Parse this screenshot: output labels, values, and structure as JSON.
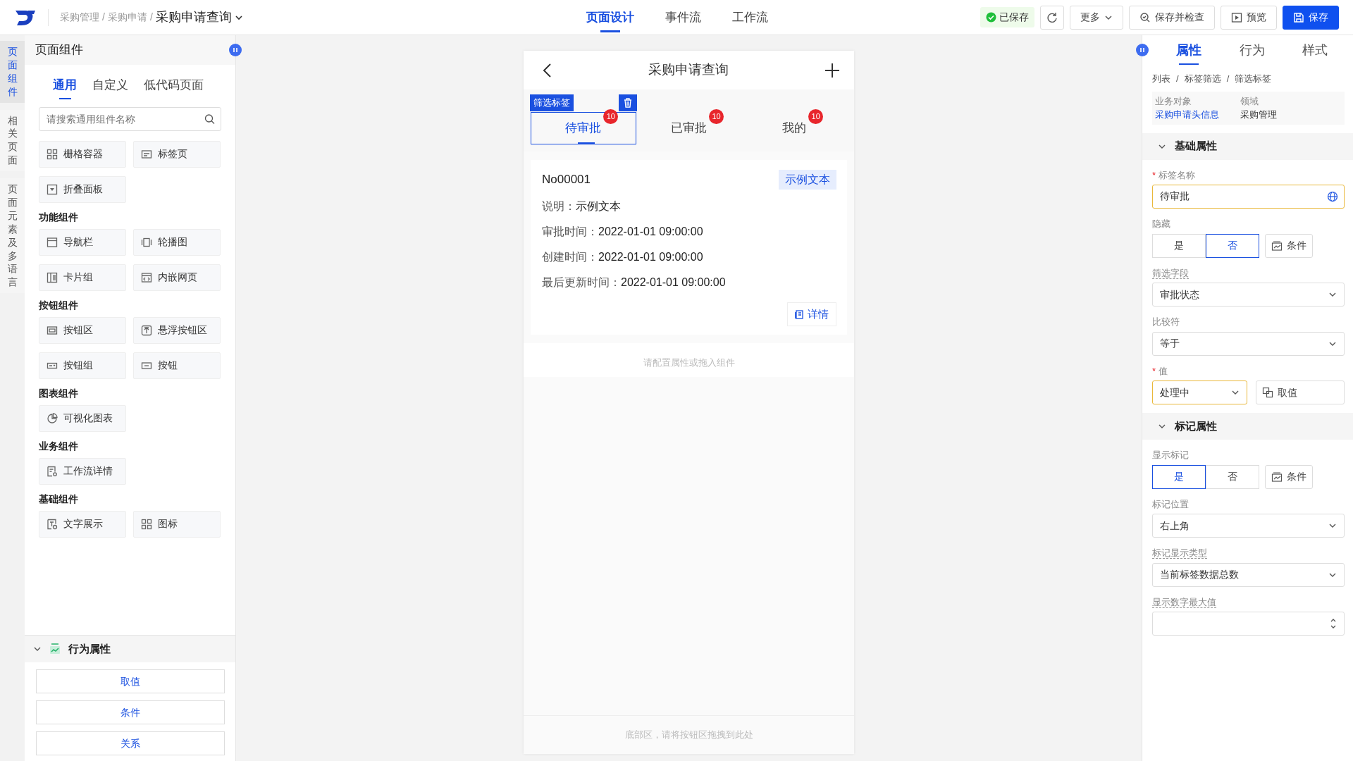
{
  "topbar": {
    "breadcrumb": [
      "采购管理",
      "采购申请"
    ],
    "separator": "/",
    "page_title": "采购申请查询",
    "tabs": [
      {
        "label": "页面设计",
        "selected": true
      },
      {
        "label": "事件流",
        "selected": false
      },
      {
        "label": "工作流",
        "selected": false
      }
    ],
    "saved_status": "已保存",
    "buttons": [
      {
        "kind": "refresh"
      },
      {
        "kind": "dropdown",
        "label": "更多"
      },
      {
        "kind": "check",
        "label": "保存并检查"
      },
      {
        "kind": "preview",
        "label": "预览"
      },
      {
        "kind": "primary",
        "label": "保存"
      }
    ]
  },
  "side_tabs": [
    {
      "label": "页面组件",
      "selected": true
    },
    {
      "label": "相关页面",
      "selected": false
    },
    {
      "label": "页面元素及多语言",
      "selected": false
    }
  ],
  "component_panel": {
    "title": "页面组件",
    "tabs": [
      {
        "label": "通用",
        "selected": true
      },
      {
        "label": "自定义",
        "selected": false
      },
      {
        "label": "低代码页面",
        "selected": false
      }
    ],
    "search": {
      "placeholder": "请搜索通用组件名称"
    },
    "groups": [
      {
        "items": [
          "栅格容器",
          "标签页",
          "折叠面板"
        ]
      },
      {
        "title": "功能组件",
        "items": [
          "导航栏",
          "轮播图",
          "卡片组",
          "内嵌网页"
        ]
      },
      {
        "title": "按钮组件",
        "items": [
          "按钮区",
          "悬浮按钮区",
          "按钮组",
          "按钮"
        ]
      },
      {
        "title": "图表组件",
        "items": [
          "可视化图表"
        ]
      },
      {
        "title": "业务组件",
        "items": [
          "工作流详情"
        ]
      },
      {
        "title": "基础组件",
        "items": [
          "文字展示",
          "图标"
        ]
      }
    ],
    "behavior": {
      "title": "行为属性",
      "expanded": true,
      "buttons": [
        "取值",
        "条件",
        "关系"
      ]
    }
  },
  "phone": {
    "title": "采购申请查询",
    "selection_label": "筛选标签",
    "tabs": [
      {
        "label": "待审批",
        "badge": "10",
        "selected": true
      },
      {
        "label": "已审批",
        "badge": "10",
        "selected": false
      },
      {
        "label": "我的",
        "badge": "10",
        "selected": false
      }
    ],
    "card": {
      "number": "No00001",
      "tag": "示例文本",
      "fields": [
        {
          "label": "说明：",
          "value": "示例文本"
        },
        {
          "label": "审批时间：",
          "value": "2022-01-01 09:00:00"
        },
        {
          "label": "创建时间：",
          "value": "2022-01-01 09:00:00"
        },
        {
          "label": "最后更新时间：",
          "value": "2022-01-01 09:00:00"
        }
      ],
      "detail_button": "详情"
    },
    "drop_hint": "请配置属性或拖入组件",
    "footer_hint": "底部区，请将按钮区拖拽到此处"
  },
  "props_panel": {
    "tabs": [
      {
        "label": "属性",
        "selected": true
      },
      {
        "label": "行为",
        "selected": false
      },
      {
        "label": "样式",
        "selected": false
      }
    ],
    "breadcrumb": [
      "列表",
      "标签筛选",
      "筛选标签"
    ],
    "separator": "/",
    "required_mark": "*",
    "info": [
      {
        "label": "业务对象",
        "value": "采购申请头信息",
        "kind": "link"
      },
      {
        "label": "领域",
        "value": "采购管理",
        "kind": "text"
      }
    ],
    "sections": [
      {
        "title": "基础属性",
        "expanded": true,
        "fields": [
          {
            "kind": "text",
            "label": "标签名称",
            "required": true,
            "underlined": false,
            "value": "待审批",
            "highlighted": true
          },
          {
            "kind": "toggle",
            "label": "隐藏",
            "required": false,
            "underlined": false,
            "options": [
              {
                "label": "是",
                "selected": false
              },
              {
                "label": "否",
                "selected": true
              }
            ],
            "button": "条件"
          },
          {
            "kind": "select",
            "label": "筛选字段",
            "required": false,
            "underlined": true,
            "value": "审批状态",
            "highlighted": false
          },
          {
            "kind": "select",
            "label": "比较符",
            "required": false,
            "underlined": false,
            "value": "等于",
            "highlighted": false
          },
          {
            "kind": "select",
            "label": "值",
            "required": true,
            "underlined": false,
            "value": "处理中",
            "highlighted": true,
            "button": "取值"
          }
        ]
      },
      {
        "title": "标记属性",
        "expanded": true,
        "fields": [
          {
            "kind": "toggle",
            "label": "显示标记",
            "required": false,
            "underlined": false,
            "options": [
              {
                "label": "是",
                "selected": true
              },
              {
                "label": "否",
                "selected": false
              }
            ],
            "button": "条件"
          },
          {
            "kind": "select",
            "label": "标记位置",
            "required": false,
            "underlined": false,
            "value": "右上角",
            "highlighted": false
          },
          {
            "kind": "select",
            "label": "标记显示类型",
            "required": false,
            "underlined": true,
            "value": "当前标签数据总数",
            "highlighted": false
          },
          {
            "kind": "number",
            "label": "显示数字最大值",
            "required": false,
            "underlined": true
          }
        ]
      }
    ]
  }
}
